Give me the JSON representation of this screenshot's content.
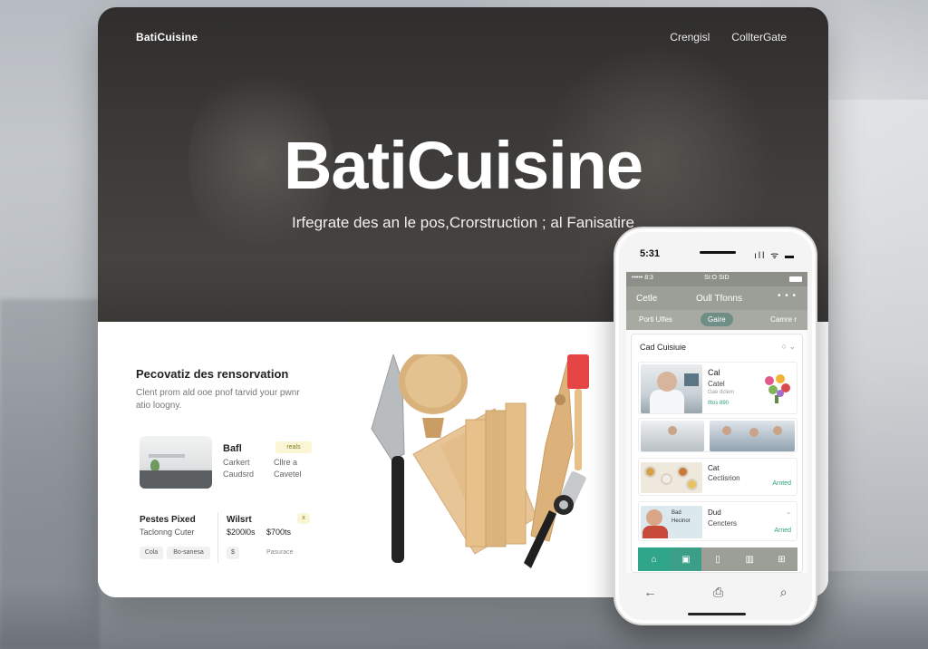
{
  "site": {
    "brand": "BatiCuisine",
    "nav": [
      "Crengisl",
      "CollterGate"
    ],
    "hero_title": "BatiCuisine",
    "hero_subtitle": "Irfegrate des an le pos,Crorstruction ; al Fanisatire"
  },
  "section": {
    "title": "Pecovatiz des rensorvation",
    "description": "Clent prom ald ooe pnof tarvid your pwnr atio loogny."
  },
  "feature_card": {
    "title": "Bafl",
    "left_line1": "Carkert",
    "left_line2": "Caudsrd",
    "right_line1": "Cllre a",
    "right_line2": "Cavetel",
    "tag": "reals"
  },
  "price_block": {
    "title": "Pestes Pixed",
    "subtitle": "Taclonng Cuter",
    "what_label": "Wilsrt",
    "price1": "$200l0s",
    "price2": "$700ts",
    "badge": "x",
    "chips": [
      "Cola",
      "Bo-sanesa",
      "$"
    ],
    "chip_text": "Pasurace"
  },
  "phone": {
    "time": "5:31",
    "status_icons": "ıll ᯤ ▬",
    "inner_status_left": "••••• 8:3",
    "inner_status_mid": "SI:O SID",
    "app_title": "Cetle",
    "app_center": "Oull Tfonns",
    "app_more": "• • •",
    "tabs": [
      "Porti Ulfes",
      "Gaire",
      "Camre r"
    ],
    "panel_title": "Cad Cuisiuie",
    "panel_control": "○ ⌄",
    "row1": {
      "title": "Cal",
      "sub": "Catel",
      "meta": "Gae dclem",
      "green": "Iftos 890"
    },
    "row3": {
      "title": "Cat",
      "sub": "Cectisrion",
      "green": "Arnted"
    },
    "row4": {
      "title": "Dud",
      "sub": "Cencters",
      "control": "⌄",
      "green": "Arned",
      "caption_line1": "Bad",
      "caption_line2": "Hecinor"
    },
    "bottom_tabs": [
      "⌂",
      "▣",
      "▯",
      "▥",
      "⊞"
    ],
    "nav_icons": [
      "←",
      "⎙",
      "⌕"
    ]
  },
  "colors": {
    "accent_green": "#2fa58a",
    "hero_dark": "#2f2e2d",
    "tag_yellow": "#faf5d5"
  }
}
